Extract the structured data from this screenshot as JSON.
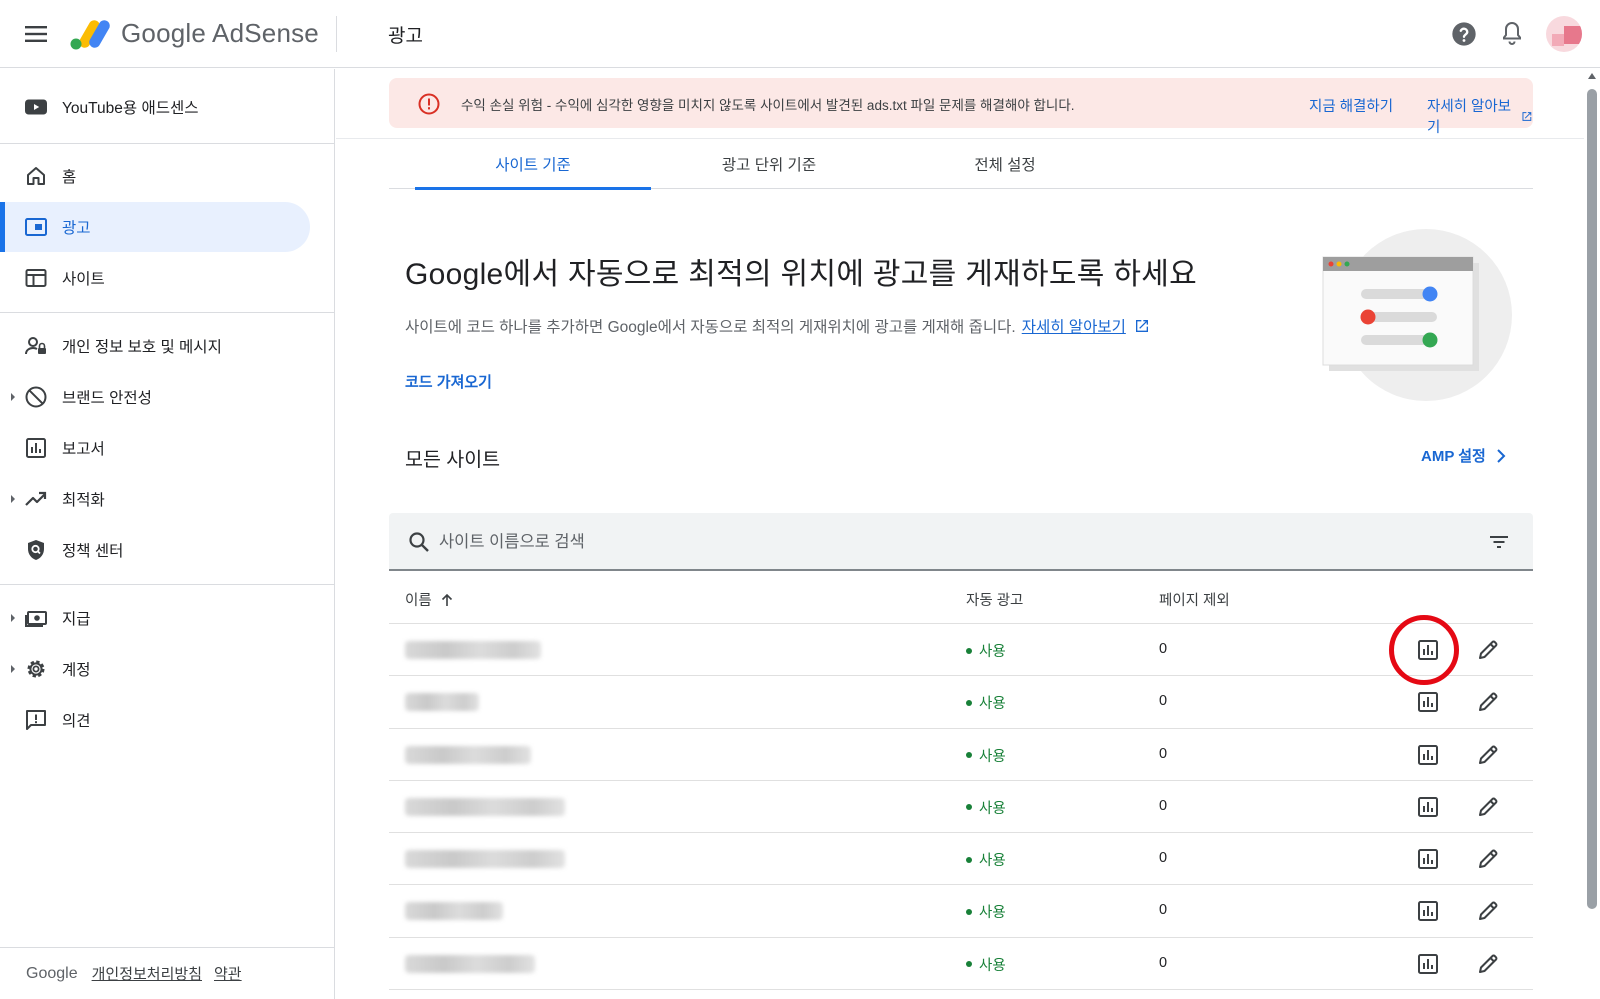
{
  "app": {
    "product_google": "Google",
    "product_adsense": "AdSense"
  },
  "header": {
    "page_title": "광고"
  },
  "sidebar": {
    "items": [
      {
        "label": "YouTube용 애드센스",
        "icon": "youtube-icon"
      },
      {
        "label": "홈",
        "icon": "home-icon"
      },
      {
        "label": "광고",
        "icon": "ads-icon",
        "active": true
      },
      {
        "label": "사이트",
        "icon": "sites-icon"
      },
      {
        "label": "개인 정보 보호 및 메시지",
        "icon": "privacy-icon"
      },
      {
        "label": "브랜드 안전성",
        "icon": "block-icon",
        "expandable": true
      },
      {
        "label": "보고서",
        "icon": "reports-icon"
      },
      {
        "label": "최적화",
        "icon": "trending-icon",
        "expandable": true
      },
      {
        "label": "정책 센터",
        "icon": "policy-icon"
      },
      {
        "label": "지급",
        "icon": "payments-icon",
        "expandable": true
      },
      {
        "label": "계정",
        "icon": "gear-icon",
        "expandable": true
      },
      {
        "label": "의견",
        "icon": "feedback-icon"
      }
    ],
    "footer": {
      "brand": "Google",
      "privacy": "개인정보처리방침",
      "terms": "약관"
    }
  },
  "alert": {
    "text": "수익 손실 위험 - 수익에 심각한 영향을 미치지 않도록 사이트에서 발견된 ads.txt 파일 문제를 해결해야 합니다.",
    "fix_label": "지금 해결하기",
    "learn_label": "자세히 알아보기",
    "color": "#fce8e6"
  },
  "tabs": [
    {
      "label": "사이트 기준",
      "active": true
    },
    {
      "label": "광고 단위 기준"
    },
    {
      "label": "전체 설정"
    }
  ],
  "hero": {
    "title": "Google에서 자동으로 최적의 위치에 광고를 게재하도록 하세요",
    "description": "사이트에 코드 하나를 추가하면 Google에서 자동으로 최적의 게재위치에 광고를 게재해 줍니다.",
    "link_label": "자세히 알아보기",
    "get_code_label": "코드 가져오기"
  },
  "sites": {
    "title": "모든 사이트",
    "amp_label": "AMP 설정",
    "search_placeholder": "사이트 이름으로 검색",
    "columns": {
      "name": "이름",
      "auto_ads": "자동 광고",
      "excluded_pages": "페이지 제외"
    },
    "rows": [
      {
        "status": "사용",
        "excluded": "0"
      },
      {
        "status": "사용",
        "excluded": "0"
      },
      {
        "status": "사용",
        "excluded": "0"
      },
      {
        "status": "사용",
        "excluded": "0"
      },
      {
        "status": "사용",
        "excluded": "0"
      },
      {
        "status": "사용",
        "excluded": "0"
      },
      {
        "status": "사용",
        "excluded": "0"
      }
    ]
  },
  "colors": {
    "accent": "#1a73e8",
    "link": "#1967d2",
    "status_on": "#188038",
    "annotation": "#e50914"
  }
}
